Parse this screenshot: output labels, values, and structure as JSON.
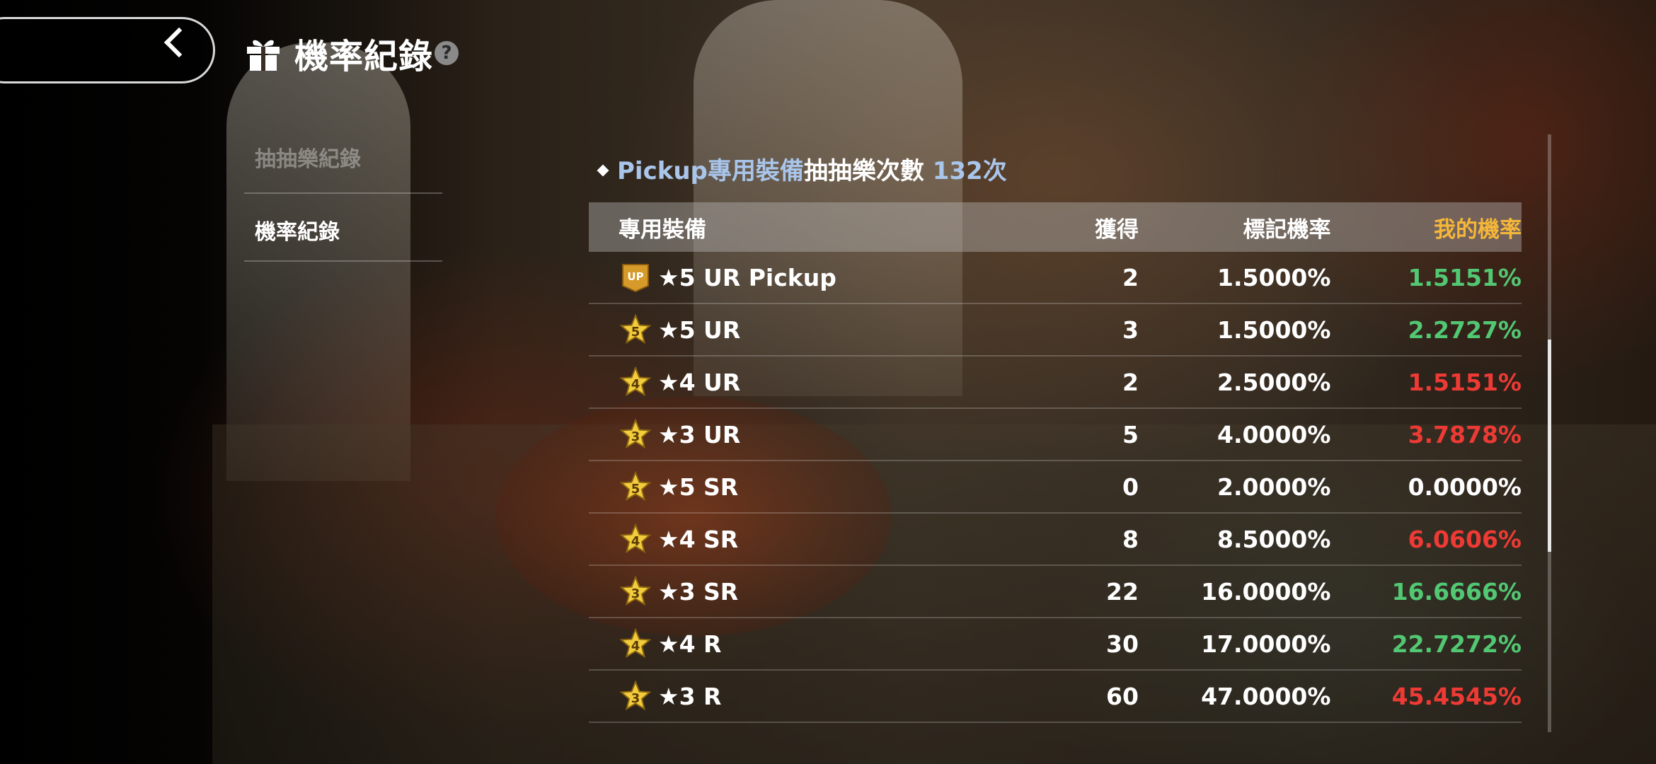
{
  "header": {
    "title": "機率紀錄",
    "back_icon": "chevron-left-icon",
    "title_icon": "gift-icon",
    "help_icon": "question-mark-icon"
  },
  "sidebar": {
    "items": [
      {
        "label": "抽抽樂紀錄",
        "active": false
      },
      {
        "label": "機率紀錄",
        "active": true
      }
    ]
  },
  "section": {
    "prefix": "Pickup專用裝備",
    "middle": "抽抽樂次數",
    "count": "132次"
  },
  "table": {
    "headers": {
      "name": "專用裝備",
      "obtained": "獲得",
      "marked_rate": "標記機率",
      "my_rate": "我的機率"
    },
    "rows": [
      {
        "badge": "UP",
        "name": "★5 UR Pickup",
        "obtained": "2",
        "marked_rate": "1.5000%",
        "my_rate": "1.5151%",
        "status": "green"
      },
      {
        "badge": "5",
        "name": "★5 UR",
        "obtained": "3",
        "marked_rate": "1.5000%",
        "my_rate": "2.2727%",
        "status": "green"
      },
      {
        "badge": "4",
        "name": "★4 UR",
        "obtained": "2",
        "marked_rate": "2.5000%",
        "my_rate": "1.5151%",
        "status": "red"
      },
      {
        "badge": "3",
        "name": "★3 UR",
        "obtained": "5",
        "marked_rate": "4.0000%",
        "my_rate": "3.7878%",
        "status": "red"
      },
      {
        "badge": "5",
        "name": "★5 SR",
        "obtained": "0",
        "marked_rate": "2.0000%",
        "my_rate": "0.0000%",
        "status": "white"
      },
      {
        "badge": "4",
        "name": "★4 SR",
        "obtained": "8",
        "marked_rate": "8.5000%",
        "my_rate": "6.0606%",
        "status": "red"
      },
      {
        "badge": "3",
        "name": "★3 SR",
        "obtained": "22",
        "marked_rate": "16.0000%",
        "my_rate": "16.6666%",
        "status": "green"
      },
      {
        "badge": "4",
        "name": "★4 R",
        "obtained": "30",
        "marked_rate": "17.0000%",
        "my_rate": "22.7272%",
        "status": "green"
      },
      {
        "badge": "3",
        "name": "★3 R",
        "obtained": "60",
        "marked_rate": "47.0000%",
        "my_rate": "45.4545%",
        "status": "red"
      }
    ]
  },
  "colors": {
    "green": "#52c873",
    "red": "#ee3a34",
    "header_accent": "#f5b73a",
    "highlight": "#a9c5ea"
  }
}
